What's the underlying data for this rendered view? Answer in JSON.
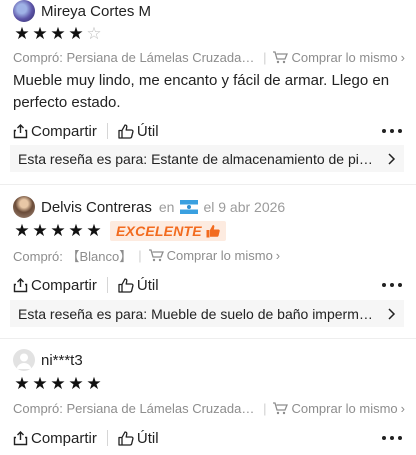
{
  "reviews": [
    {
      "username": "Mireya Cortes M",
      "rating": 4,
      "purchased": "Compró: Persiana de Lámelas Cruzadas ...",
      "buy_same": "Comprar lo mismo",
      "text": "Mueble muy lindo, me encanto y fácil de armar. Llego en perfecto estado.",
      "share_label": "Compartir",
      "helpful_label": "Útil",
      "target": "Esta reseña es para: Estante de almacenamiento de pie p..."
    },
    {
      "username": "Delvis Contreras",
      "country_prefix": "en",
      "date": "el 9 abr 2026",
      "rating": 5,
      "badge": "EXCELENTE",
      "purchased": "Compró: 【Blanco】",
      "buy_same": "Comprar lo mismo",
      "share_label": "Compartir",
      "helpful_label": "Útil",
      "target": "Esta reseña es para: Mueble de suelo de baño impermeab..."
    },
    {
      "username": "ni***t3",
      "rating": 5,
      "purchased": "Compró: Persiana de Lámelas Cruzadas ...",
      "buy_same": "Comprar lo mismo",
      "share_label": "Compartir",
      "helpful_label": "Útil"
    }
  ],
  "icons": {
    "share": "share-icon",
    "helpful": "thumbs-up-icon",
    "cart": "cart-icon",
    "more": "more-options-icon",
    "chevron": "chevron-right-icon"
  },
  "colors": {
    "badge_text": "#f26b1f",
    "badge_bg": "#fdebe0",
    "muted_text": "#8d8d8d",
    "bar_bg": "#f6f6f6"
  }
}
